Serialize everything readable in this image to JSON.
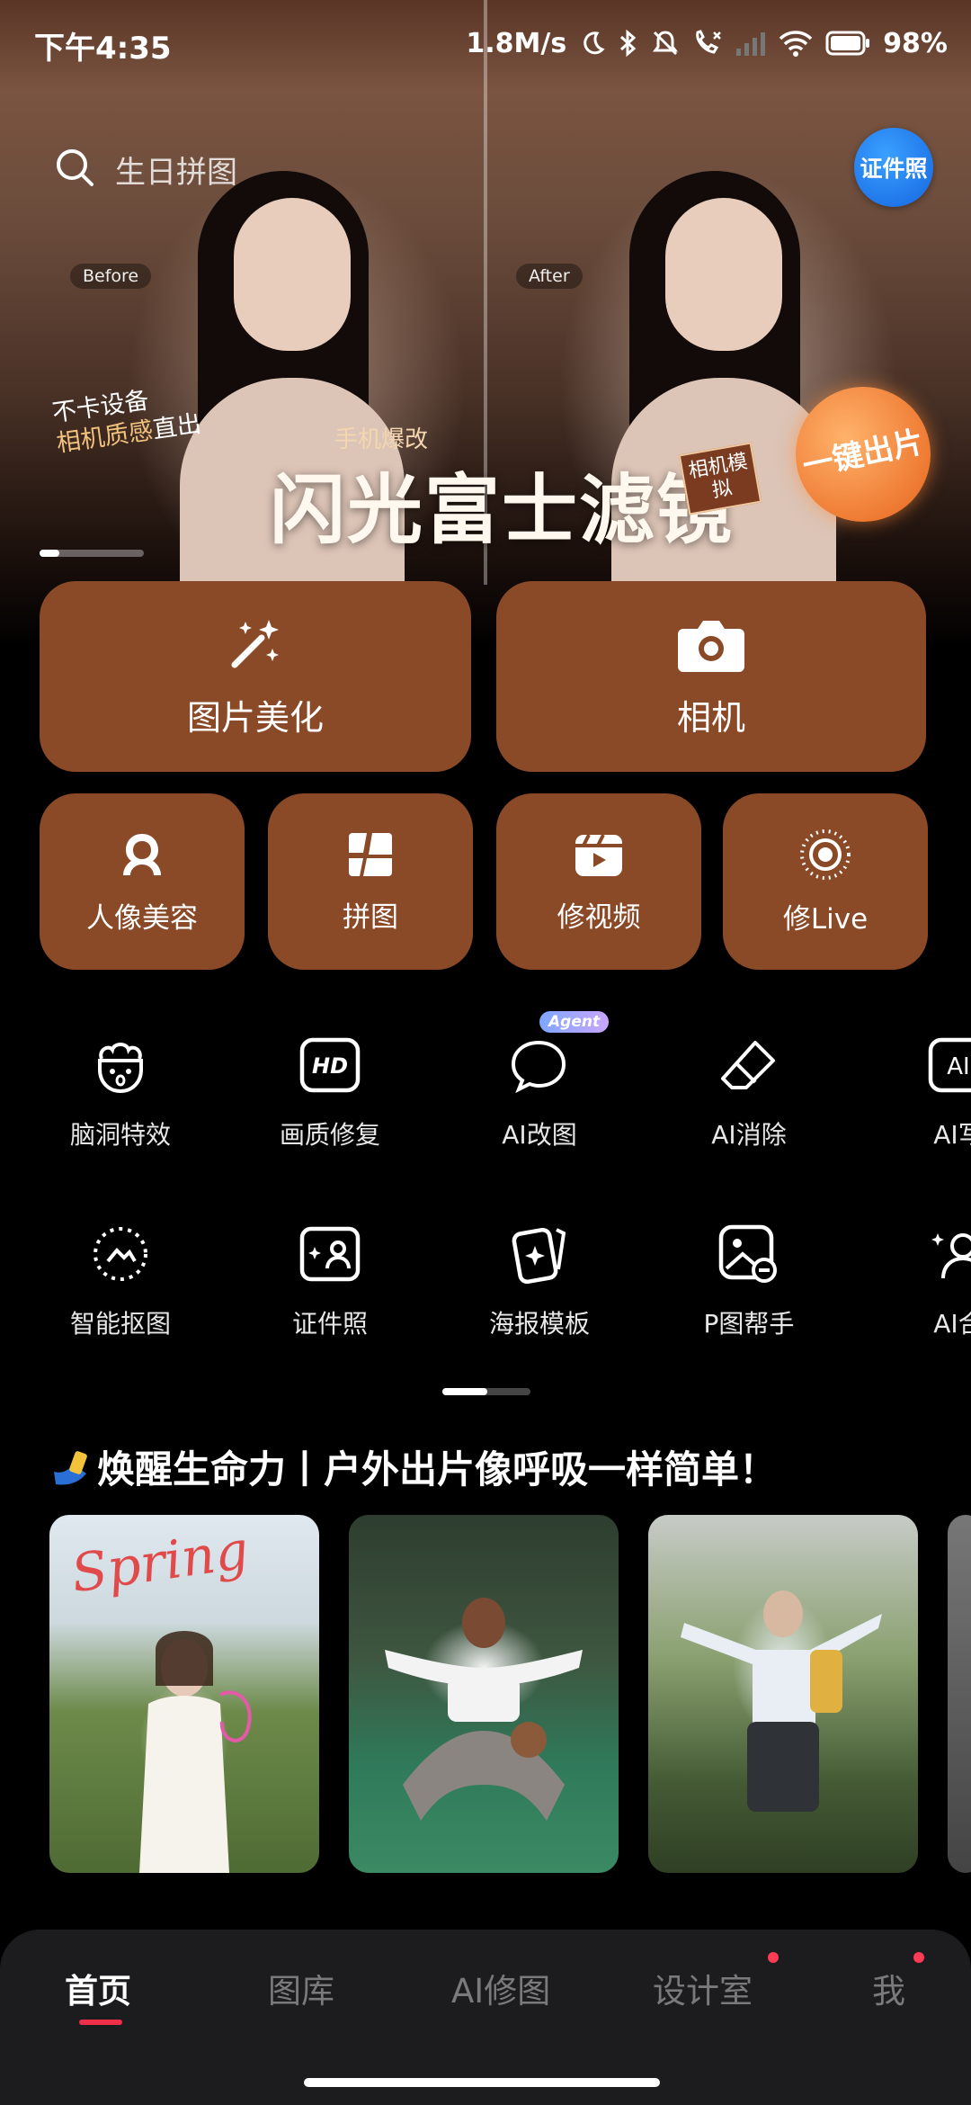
{
  "status_bar": {
    "time": "下午4:35",
    "network_speed": "1.8M/s",
    "battery": "98%",
    "icons": [
      "moon-icon",
      "bluetooth-icon",
      "mute-icon",
      "call-icon",
      "signal-icon",
      "wifi-icon",
      "battery-icon"
    ]
  },
  "search": {
    "placeholder": "生日拼图",
    "icon": "search-icon"
  },
  "id_photo_badge": {
    "label": "证件照"
  },
  "banner": {
    "before_label": "Before",
    "after_label": "After",
    "slogan_line1": "不卡设备",
    "slogan_line2": "相机质感",
    "slogan_line3": "直出",
    "subtitle": "手机爆改",
    "title": "闪光富士滤镜",
    "badge_camera": "相机模拟",
    "badge_one_click": "一键出片"
  },
  "main_tiles": [
    {
      "label": "图片美化",
      "icon": "magic-wand-icon"
    },
    {
      "label": "相机",
      "icon": "camera-icon"
    }
  ],
  "sub_tiles": [
    {
      "label": "人像美容",
      "icon": "portrait-icon"
    },
    {
      "label": "拼图",
      "icon": "collage-icon"
    },
    {
      "label": "修视频",
      "icon": "video-icon"
    },
    {
      "label": "修Live",
      "icon": "live-icon"
    }
  ],
  "tools_row1": [
    {
      "label": "脑洞特效",
      "icon": "brain-effect-icon"
    },
    {
      "label": "画质修复",
      "icon": "hd-icon"
    },
    {
      "label": "AI改图",
      "icon": "ai-chat-icon",
      "tag": "Agent"
    },
    {
      "label": "AI消除",
      "icon": "eraser-icon"
    },
    {
      "label": "AI写",
      "icon": "ai-text-icon"
    }
  ],
  "tools_row2": [
    {
      "label": "智能抠图",
      "icon": "cutout-icon"
    },
    {
      "label": "证件照",
      "icon": "id-photo-icon"
    },
    {
      "label": "海报模板",
      "icon": "poster-icon"
    },
    {
      "label": "P图帮手",
      "icon": "helper-icon"
    },
    {
      "label": "AI合",
      "icon": "ai-compose-icon"
    }
  ],
  "article": {
    "title": "焕醒生命力丨户外出片像呼吸一样简单！",
    "card1_overlay": "Spring"
  },
  "bottom_nav": [
    {
      "label": "首页",
      "active": true
    },
    {
      "label": "图库",
      "active": false
    },
    {
      "label": "AI修图",
      "active": false
    },
    {
      "label": "设计室",
      "active": false,
      "dot": true
    },
    {
      "label": "我",
      "active": false,
      "dot": true
    }
  ],
  "colors": {
    "tile": "#8a4a28",
    "nav_active_underline": "#ef2f4a",
    "badge_blue": "#1f7af0"
  }
}
